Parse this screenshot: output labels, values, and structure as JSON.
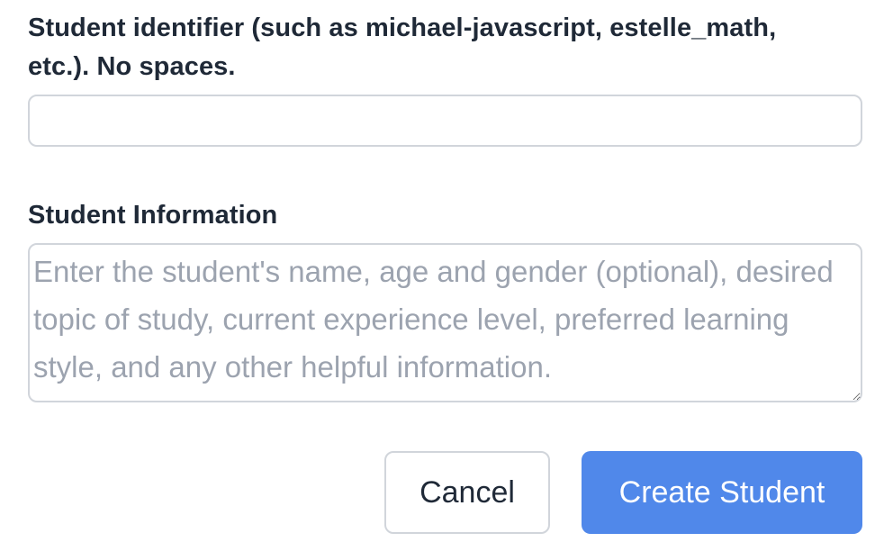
{
  "form": {
    "identifier": {
      "label": "Student identifier (such as michael-javascript, estelle_math, etc.). No spaces.",
      "value": "",
      "placeholder": ""
    },
    "info": {
      "label": "Student Information",
      "value": "",
      "placeholder": "Enter the student's name, age and gender (optional), desired topic of study, current experience level, preferred learning style, and any other helpful information."
    },
    "actions": {
      "cancel_label": "Cancel",
      "create_label": "Create Student"
    }
  },
  "colors": {
    "primary": "#5088ea",
    "border": "#d1d5db",
    "placeholder": "#9ca3af",
    "text": "#1f2937"
  }
}
